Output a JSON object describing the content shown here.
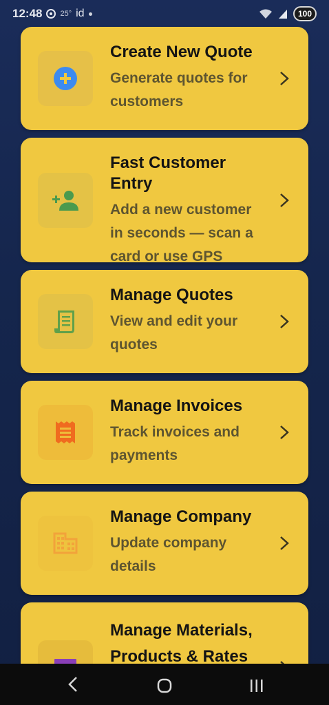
{
  "status": {
    "time": "12:48",
    "temp": "25°",
    "locale": "id",
    "battery": "100"
  },
  "cards": [
    {
      "title": "Create New Quote",
      "description": "Generate quotes for customers",
      "icon": "add-circle-icon"
    },
    {
      "title": "Fast Customer Entry",
      "description": "Add a new customer in seconds — scan a card or use GPS",
      "icon": "person-add-icon"
    },
    {
      "title": "Manage Quotes",
      "description": "View and edit your quotes",
      "icon": "receipt-scroll-icon"
    },
    {
      "title": "Manage Invoices",
      "description": "Track invoices and payments",
      "icon": "receipt-icon"
    },
    {
      "title": "Manage Company",
      "description": "Update company details",
      "icon": "building-icon"
    },
    {
      "title": "Manage Materials, Products & Rates",
      "description": "",
      "icon": "inventory-icon"
    }
  ],
  "colors": {
    "card": "#f0c840",
    "background": "#1a2c59",
    "icon_blue": "#3d8bf0",
    "icon_green": "#4a9a4e",
    "icon_orange": "#f06b1f",
    "icon_amber": "#f2a33a",
    "icon_purple": "#8a3fb8"
  }
}
